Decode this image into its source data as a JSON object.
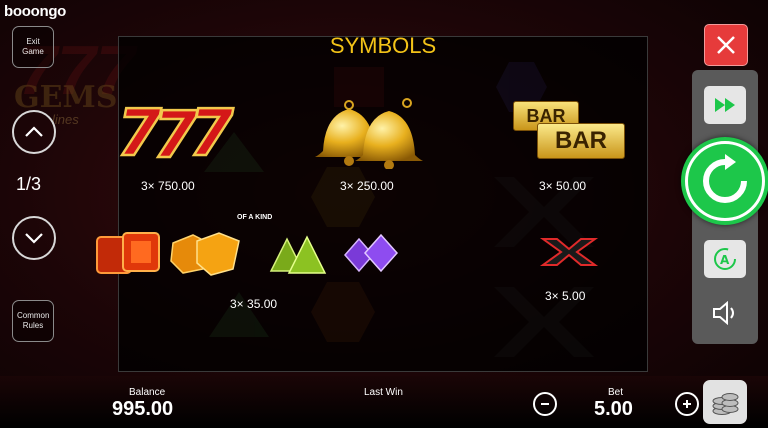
{
  "brand": {
    "logo": "booongo"
  },
  "background": {
    "game_title": "GEMS",
    "game_subtitle": "lines"
  },
  "left_controls": {
    "exit_label": "Exit Game",
    "page_indicator": "1/3",
    "common_rules_label": "Common Rules"
  },
  "paytable": {
    "title": "SYMBOLS",
    "sevens_payout": "3×  750.00",
    "bells_payout": "3×  250.00",
    "bar_payout": "3×  50.00",
    "gems_label": "OF A KIND",
    "gems_payout": "3×  35.00",
    "x_payout": "3×  5.00",
    "bar_text": "BAR"
  },
  "bottom": {
    "balance_label": "Balance",
    "balance_value": "995.00",
    "last_win_label": "Last Win",
    "bet_label": "Bet",
    "bet_value": "5.00"
  },
  "colors": {
    "title_gold": "#f3c318",
    "spin_green": "#1dc74a",
    "close_red": "#e63b3b"
  }
}
